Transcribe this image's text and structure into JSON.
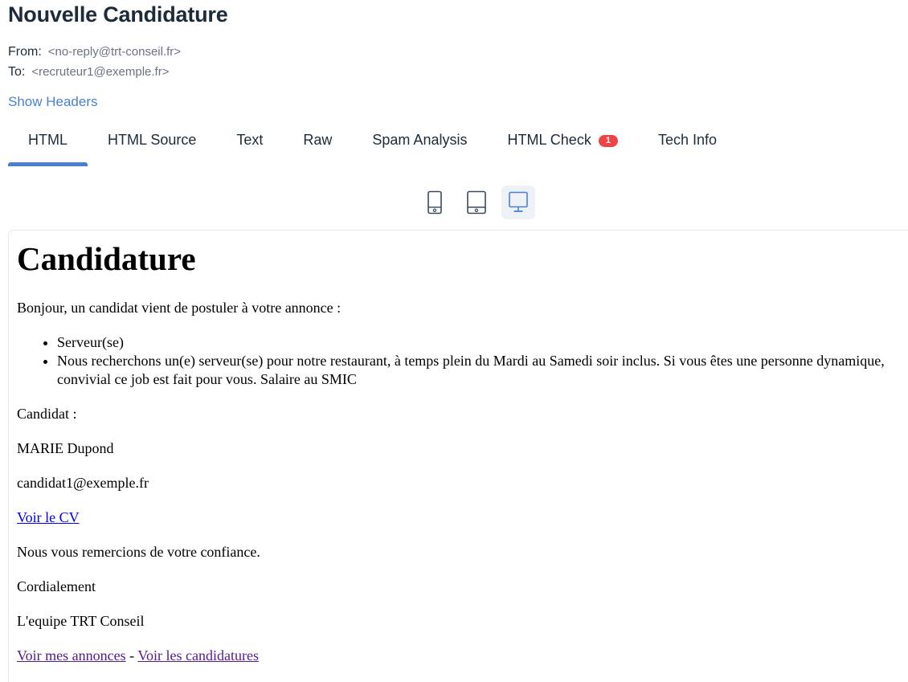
{
  "email": {
    "subject": "Nouvelle Candidature",
    "from_label": "From:",
    "from_value": "<no-reply@trt-conseil.fr>",
    "to_label": "To:",
    "to_value": "<recruteur1@exemple.fr>",
    "show_headers": "Show Headers"
  },
  "tabs": [
    {
      "label": "HTML",
      "active": true
    },
    {
      "label": "HTML Source"
    },
    {
      "label": "Text"
    },
    {
      "label": "Raw"
    },
    {
      "label": "Spam Analysis"
    },
    {
      "label": "HTML Check",
      "badge": "1"
    },
    {
      "label": "Tech Info"
    }
  ],
  "devices": {
    "icons": [
      "mobile-icon",
      "tablet-icon",
      "desktop-icon"
    ],
    "active": "desktop-icon"
  },
  "body": {
    "heading": "Candidature",
    "intro": "Bonjour, un candidat vient de postuler à votre annonce :",
    "offer": [
      "Serveur(se)",
      "Nous recherchons un(e) serveur(se) pour notre restaurant, à temps plein du Mardi au Samedi soir inclus. Si vous êtes une personne dynamique, convivial ce job est fait pour vous. Salaire au SMIC"
    ],
    "candidate_label": "Candidat :",
    "candidate_name": "MARIE Dupond",
    "candidate_email": "candidat1@exemple.fr",
    "cv_link": "Voir le CV",
    "thanks": "Nous vous remercions de votre confiance.",
    "closing": "Cordialement",
    "signature": "L'equipe TRT Conseil",
    "link_annonces": "Voir mes annonces",
    "separator": " - ",
    "link_candidatures": "Voir les candidatures"
  },
  "colors": {
    "accent": "#4a7fd4",
    "badge": "#ef4444",
    "link": "#0000ee",
    "visited_link": "#551a8b"
  }
}
